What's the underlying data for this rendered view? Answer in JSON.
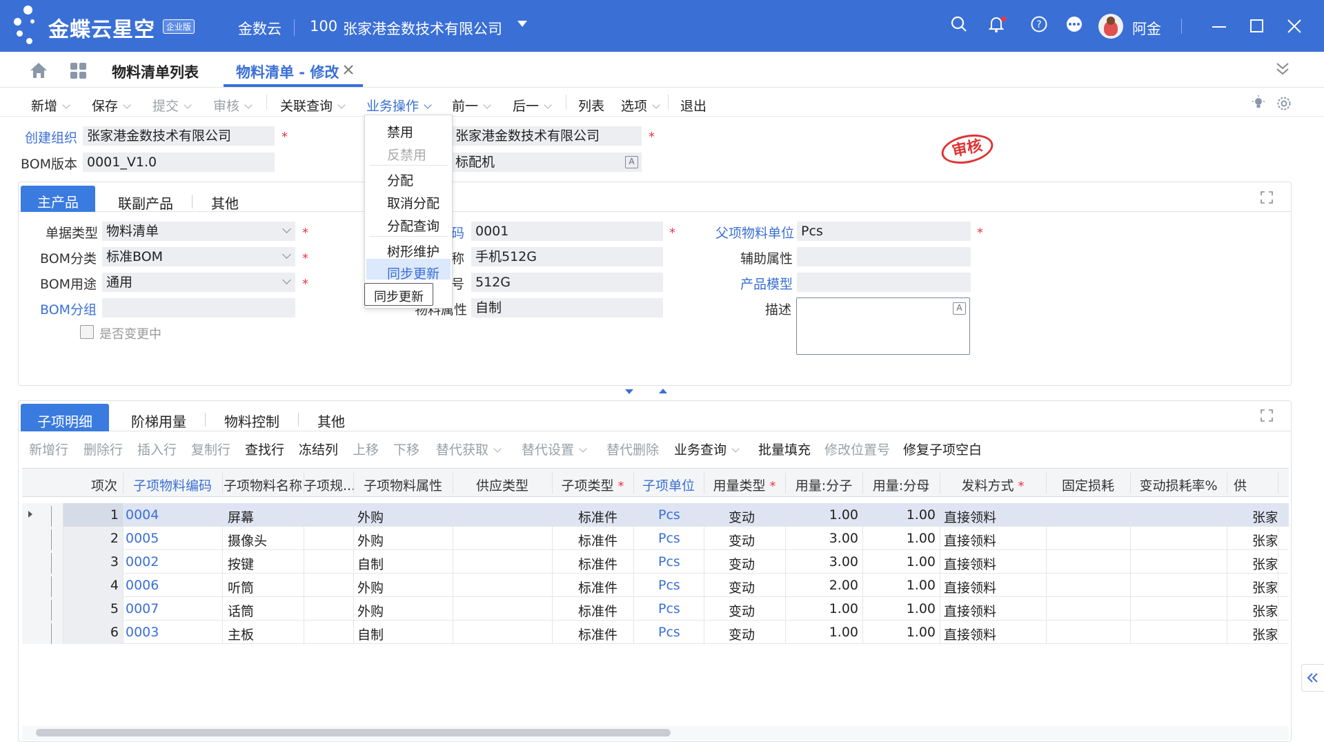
{
  "app": {
    "logo_text": "金蝶云星空",
    "logo_badge": "企业版",
    "tenant": "金数云",
    "org_code": "100",
    "org_name": "张家港金数技术有限公司",
    "user_name": "阿金",
    "accent_color": "#3a6fd6"
  },
  "tabs": [
    {
      "label": "物料清单列表"
    },
    {
      "label": "物料清单 - 修改"
    }
  ],
  "toolbar": {
    "buttons": [
      "新增",
      "保存",
      "提交",
      "审核",
      "关联查询",
      "业务操作",
      "前一",
      "后一",
      "列表",
      "选项",
      "退出"
    ]
  },
  "header_form": {
    "create_org_label": "创建组织",
    "create_org_value": "张家港金数技术有限公司",
    "bom_version_label": "BOM版本",
    "bom_version_value": "0001_V1.0",
    "use_org_value": "张家港金数技术有限公司",
    "name_value": "标配机",
    "stamp_text": "审核"
  },
  "dropdown_menu": {
    "items": [
      "禁用",
      "反禁用",
      "分配",
      "取消分配",
      "分配查询",
      "树形维护",
      "同步更新"
    ],
    "tooltip": "同步更新"
  },
  "main_panel": {
    "tabs": [
      "主产品",
      "联副产品",
      "其他"
    ],
    "doc_type_label": "单据类型",
    "doc_type_value": "物料清单",
    "bom_class_label": "BOM分类",
    "bom_class_value": "标准BOM",
    "bom_use_label": "BOM用途",
    "bom_use_value": "通用",
    "bom_group_label": "BOM分组",
    "bom_group_value": "",
    "changing_label": "是否变更中",
    "material_code_label_tail": "码",
    "material_code_value": "0001",
    "material_name_label_tail": "称",
    "material_name_value": "手机512G",
    "spec_label_tail": "号",
    "spec_value": "512G",
    "material_attr_label": "物料属性",
    "material_attr_value": "自制",
    "parent_unit_label": "父项物料单位",
    "parent_unit_value": "Pcs",
    "aux_attr_label": "辅助属性",
    "aux_attr_value": "",
    "product_model_label": "产品模型",
    "product_model_value": "",
    "desc_label": "描述",
    "desc_value": ""
  },
  "detail_panel": {
    "tabs": [
      "子项明细",
      "阶梯用量",
      "物料控制",
      "其他"
    ],
    "toolbar": [
      "新增行",
      "删除行",
      "插入行",
      "复制行",
      "查找行",
      "冻结列",
      "上移",
      "下移",
      "替代获取",
      "替代设置",
      "替代删除",
      "业务查询",
      "批量填充",
      "修改位置号",
      "修复子项空白"
    ],
    "columns": [
      "项次",
      "子项物料编码",
      "子项物料名称",
      "子项规...",
      "子项物料属性",
      "供应类型",
      "子项类型",
      "子项单位",
      "用量类型",
      "用量:分子",
      "用量:分母",
      "发料方式",
      "固定损耗",
      "变动损耗率%",
      "供"
    ],
    "rows": [
      {
        "seq": "1",
        "code": "0004",
        "name": "屏幕",
        "spec": "",
        "attr": "外购",
        "supply": "",
        "type": "标准件",
        "unit": "Pcs",
        "qty_type": "变动",
        "num": "1.00",
        "den": "1.00",
        "issue": "直接领料",
        "fixed": "",
        "var": "",
        "org": "张家"
      },
      {
        "seq": "2",
        "code": "0005",
        "name": "摄像头",
        "spec": "",
        "attr": "外购",
        "supply": "",
        "type": "标准件",
        "unit": "Pcs",
        "qty_type": "变动",
        "num": "3.00",
        "den": "1.00",
        "issue": "直接领料",
        "fixed": "",
        "var": "",
        "org": "张家"
      },
      {
        "seq": "3",
        "code": "0002",
        "name": "按键",
        "spec": "",
        "attr": "自制",
        "supply": "",
        "type": "标准件",
        "unit": "Pcs",
        "qty_type": "变动",
        "num": "3.00",
        "den": "1.00",
        "issue": "直接领料",
        "fixed": "",
        "var": "",
        "org": "张家"
      },
      {
        "seq": "4",
        "code": "0006",
        "name": "听筒",
        "spec": "",
        "attr": "外购",
        "supply": "",
        "type": "标准件",
        "unit": "Pcs",
        "qty_type": "变动",
        "num": "2.00",
        "den": "1.00",
        "issue": "直接领料",
        "fixed": "",
        "var": "",
        "org": "张家"
      },
      {
        "seq": "5",
        "code": "0007",
        "name": "话筒",
        "spec": "",
        "attr": "外购",
        "supply": "",
        "type": "标准件",
        "unit": "Pcs",
        "qty_type": "变动",
        "num": "1.00",
        "den": "1.00",
        "issue": "直接领料",
        "fixed": "",
        "var": "",
        "org": "张家"
      },
      {
        "seq": "6",
        "code": "0003",
        "name": "主板",
        "spec": "",
        "attr": "自制",
        "supply": "",
        "type": "标准件",
        "unit": "Pcs",
        "qty_type": "变动",
        "num": "1.00",
        "den": "1.00",
        "issue": "直接领料",
        "fixed": "",
        "var": "",
        "org": "张家"
      }
    ]
  }
}
